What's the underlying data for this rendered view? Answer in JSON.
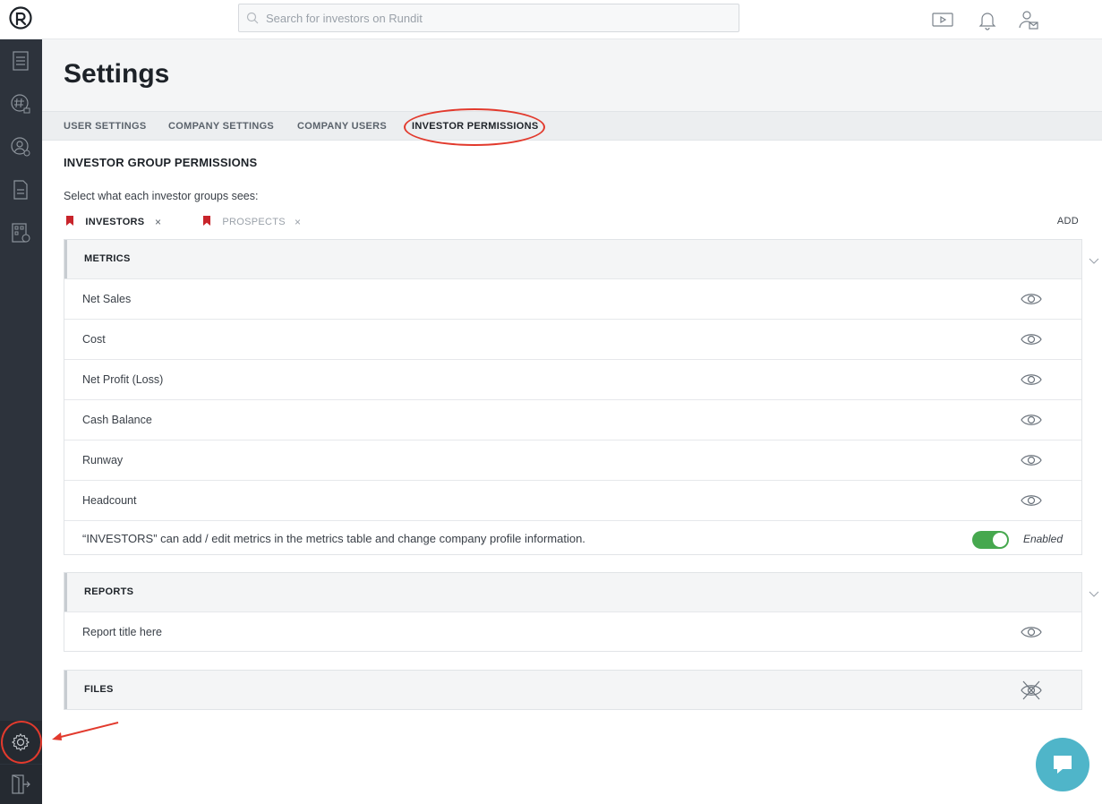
{
  "topbar": {
    "search_placeholder": "Search for investors on Rundit"
  },
  "page": {
    "title": "Settings"
  },
  "tabs": [
    {
      "label": "USER SETTINGS",
      "active": false
    },
    {
      "label": "COMPANY SETTINGS",
      "active": false
    },
    {
      "label": "COMPANY USERS",
      "active": false
    },
    {
      "label": "INVESTOR PERMISSIONS",
      "active": true
    }
  ],
  "permissions": {
    "heading": "INVESTOR GROUP PERMISSIONS",
    "hint": "Select what each investor groups sees:",
    "groups": [
      {
        "label": "INVESTORS",
        "selected": true,
        "remove": "×"
      },
      {
        "label": "PROSPECTS",
        "selected": false,
        "remove": "×"
      }
    ],
    "add_label": "ADD"
  },
  "metrics": {
    "title": "METRICS",
    "rows": [
      {
        "label": "Net Sales",
        "visibility": "eye-icon"
      },
      {
        "label": "Cost",
        "visibility": "eye-icon"
      },
      {
        "label": "Net Profit (Loss)",
        "visibility": "eye-icon"
      },
      {
        "label": "Cash Balance",
        "visibility": "eye-icon"
      },
      {
        "label": "Runway",
        "visibility": "eye-icon"
      },
      {
        "label": "Headcount",
        "visibility": "eye-icon"
      }
    ],
    "edit_permission_text": "“INVESTORS” can add / edit metrics in the metrics table and change company profile information.",
    "edit_permission_state": "Enabled",
    "edit_permission_on": true
  },
  "reports": {
    "title": "REPORTS",
    "rows": [
      {
        "label": "Report title here",
        "visibility": "eye-icon"
      }
    ]
  },
  "files": {
    "title": "FILES",
    "visibility": "eye-slash-icon"
  },
  "colors": {
    "sidebar": "#2d333c",
    "accent_red": "#e23a2d",
    "toggle_green": "#46a84e",
    "chat": "#4fb5c9"
  }
}
